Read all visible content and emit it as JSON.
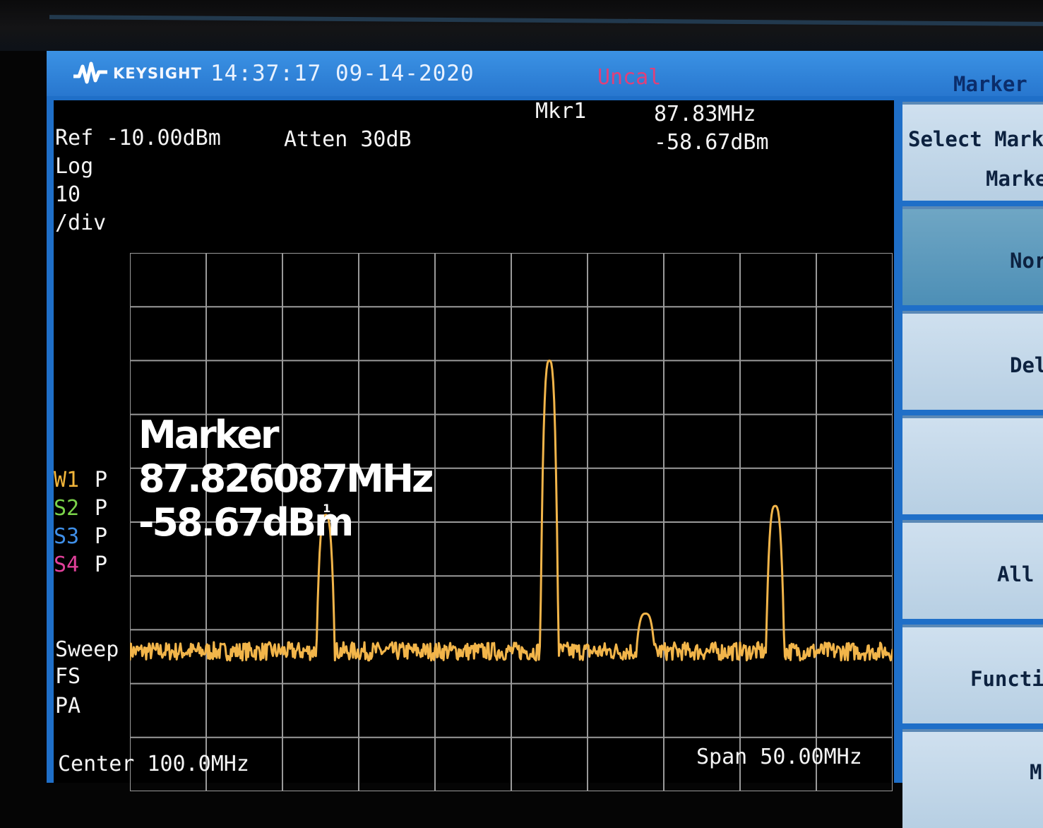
{
  "header": {
    "brand": "KEYSIGHT",
    "datetime": "14:37:17 09-14-2020",
    "status": "Uncal",
    "menu_title": "Marker"
  },
  "marker_readout": {
    "label": "Mkr1",
    "frequency": "87.83MHz",
    "amplitude": "-58.67dBm"
  },
  "settings": {
    "ref": "Ref -10.00dBm",
    "atten": "Atten 30dB",
    "scale_lines": [
      "Log",
      "10",
      "/div"
    ]
  },
  "traces": [
    {
      "label": "W1",
      "mode": "P",
      "color": "#f0b43a"
    },
    {
      "label": "S2",
      "mode": "P",
      "color": "#7bd34a"
    },
    {
      "label": "S3",
      "mode": "P",
      "color": "#3f8fe8"
    },
    {
      "label": "S4",
      "mode": "P",
      "color": "#e0409a"
    }
  ],
  "sweep": {
    "lines": [
      "Sweep",
      "FS",
      "PA"
    ]
  },
  "footer": {
    "center": "Center 100.0MHz",
    "span": "Span 50.00MHz"
  },
  "overlay": {
    "title": "Marker",
    "frequency": "87.826087MHz",
    "amplitude": "-58.67dBm"
  },
  "softkeys": [
    {
      "lines": [
        "Select Mark",
        "Marke"
      ],
      "active": false
    },
    {
      "lines": [
        "Nor"
      ],
      "active": true
    },
    {
      "lines": [
        "Del"
      ],
      "active": false
    },
    {
      "lines": [
        ""
      ],
      "active": false
    },
    {
      "lines": [
        "All"
      ],
      "active": false
    },
    {
      "lines": [
        "Functi"
      ],
      "active": false
    },
    {
      "lines": [
        "M"
      ],
      "active": false
    }
  ],
  "chart_data": {
    "type": "line",
    "x_range_mhz": [
      75,
      125
    ],
    "ylim": [
      -110,
      -10
    ],
    "y_unit": "dBm",
    "grid": true,
    "trace_color": "#f2b54a",
    "noise_floor": -84,
    "peaks": [
      {
        "freq_mhz": 87.83,
        "level_dbm": -58.67
      },
      {
        "freq_mhz": 102.5,
        "level_dbm": -30
      },
      {
        "freq_mhz": 108.8,
        "level_dbm": -77
      },
      {
        "freq_mhz": 117.3,
        "level_dbm": -57
      }
    ],
    "marker": {
      "label": "1",
      "freq_mhz": 87.83,
      "level_dbm": -58.67
    }
  }
}
